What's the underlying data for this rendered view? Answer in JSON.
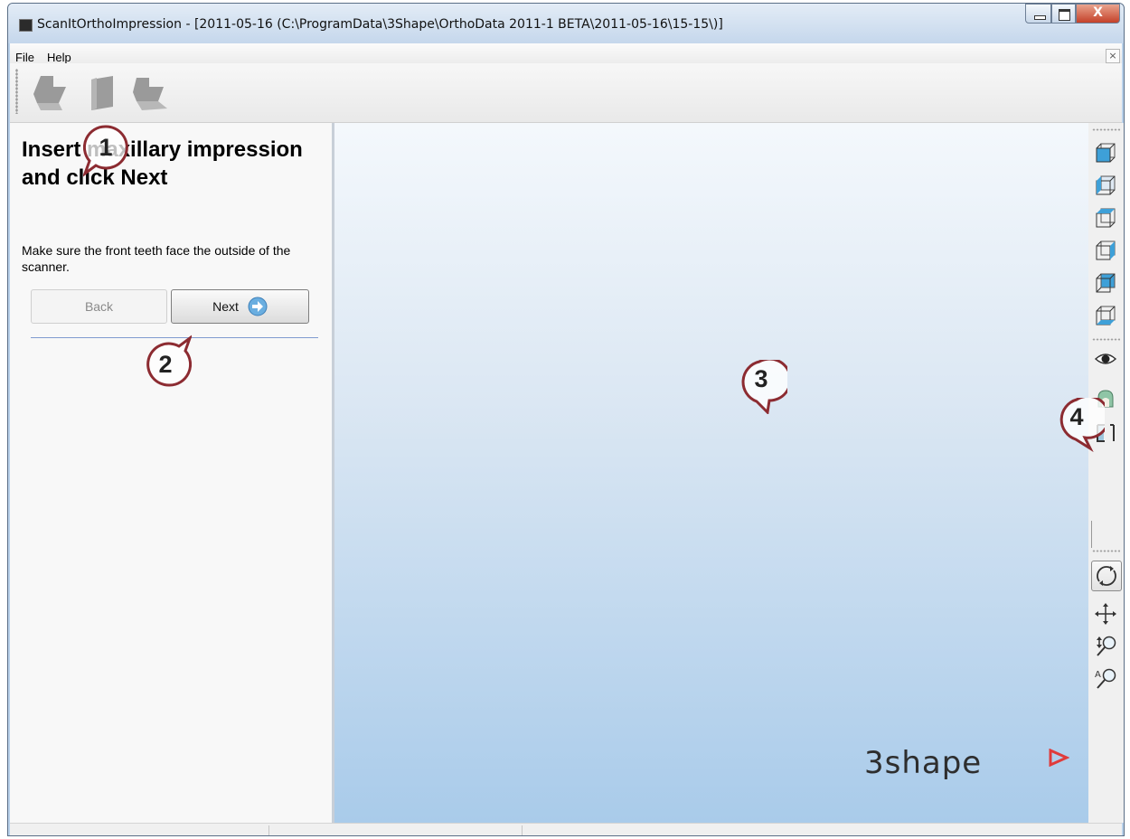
{
  "window": {
    "title": "ScanItOrthoImpression - [2011-05-16 (C:\\ProgramData\\3Shape\\OrthoData 2011-1 BETA\\2011-05-16\\15-15\\)]",
    "minimize_icon": "minimize-icon",
    "maximize_icon": "maximize-icon",
    "close_label": "X"
  },
  "menu": {
    "items": [
      {
        "label": "File"
      },
      {
        "label": "Help"
      }
    ],
    "mdi_close_label": "×"
  },
  "toolbar": {
    "icons": [
      "upper-arch-icon",
      "scan-block-icon",
      "lower-arch-icon"
    ]
  },
  "left_panel": {
    "title": "Insert maxillary impression and click Next",
    "description": "Make sure the front teeth face the outside of the scanner.",
    "back_label": "Back",
    "next_label": "Next",
    "next_icon": "arrow-right-circle-icon"
  },
  "viewport": {
    "logo_text": "3shape",
    "background_top": "#f4f8fc",
    "background_bottom": "#a9cbea"
  },
  "right_toolbar": {
    "view_icons": [
      "view-top-icon",
      "view-front-icon",
      "view-left-icon",
      "view-right-icon",
      "view-back-icon",
      "view-bottom-icon"
    ],
    "display_icons": [
      "eye-icon",
      "impression-icon",
      "crop-bracket-icon"
    ],
    "tool_icons": [
      "rotate-icon",
      "pan-icon",
      "zoom-vertical-icon",
      "zoom-auto-icon"
    ]
  },
  "callouts": [
    {
      "label": "1"
    },
    {
      "label": "2"
    },
    {
      "label": "3"
    },
    {
      "label": "4"
    }
  ],
  "status_bar": {
    "cells": [
      "",
      "",
      ""
    ]
  },
  "colors": {
    "accent_callout": "#8c2b31",
    "separator_blue": "#7f9bd0",
    "logo_mark": "#e03b3b"
  }
}
